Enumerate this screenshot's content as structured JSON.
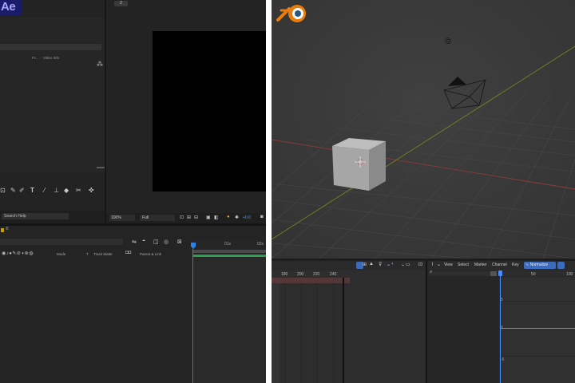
{
  "after_effects": {
    "logo_text": "Ae",
    "comp_tab": "2",
    "project_panel": {
      "columns": [
        "Fr...",
        "Video Info"
      ]
    },
    "search_help": "Search Help",
    "viewer": {
      "zoom": "100%",
      "resolution": "Full",
      "exposure": "+0.0"
    },
    "timeline": {
      "tab_label": "≡",
      "columns": {
        "mode": "Mode",
        "t": "T",
        "track_matte": "Track Matte",
        "parent": "Parent & Link"
      },
      "ruler": [
        "01s",
        "02s"
      ]
    },
    "accent_color": "#2f83e6"
  },
  "blender": {
    "header_menus": [
      "View",
      "Select",
      "Marker",
      "Channel",
      "Key"
    ],
    "mode": "Normalize",
    "dope_ruler": [
      "180",
      "200",
      "220",
      "240"
    ],
    "graph_ruler": [
      "50",
      "100"
    ],
    "graph_values": [
      "5",
      "0",
      "-5"
    ],
    "accent_color": "#4a8cff"
  }
}
